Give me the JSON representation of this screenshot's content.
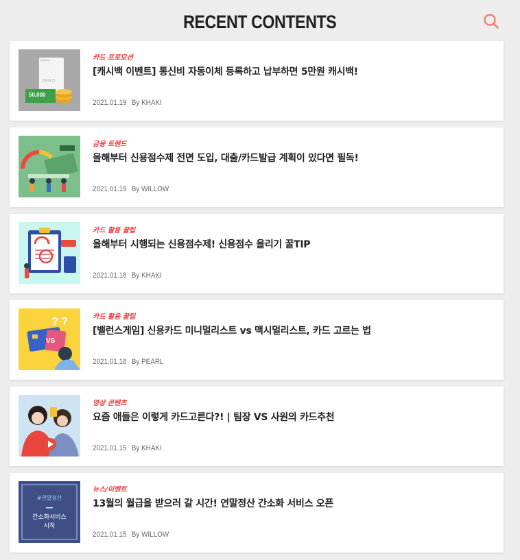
{
  "header": {
    "title": "RECENT CONTENTS",
    "search_icon": "search-icon",
    "accent": "#f07867"
  },
  "colors": {
    "category": "#ef3a3a",
    "background": "#ededed"
  },
  "posts": [
    {
      "category": "카드 프로모션",
      "title": "[캐시백 이벤트] 통신비 자동이체 등록하고 납부하면 5만원 캐시백!",
      "date": "2021.01.19",
      "by": "By",
      "author": "KHAKI",
      "thumb": {
        "card_text": "ZERO",
        "amount": "50,000"
      }
    },
    {
      "category": "금융 트렌드",
      "title": "올해부터 신용점수제 전면 도입, 대출/카드발급 계획이 있다면 필독!",
      "date": "2021.01.19",
      "by": "By",
      "author": "WILLOW"
    },
    {
      "category": "카드 활용 꿀팁",
      "title": "올해부터 시행되는 신용점수제! 신용점수 올리기 꿀TIP",
      "date": "2021.01.18",
      "by": "By",
      "author": "KHAKI"
    },
    {
      "category": "카드 활용 꿀팁",
      "title": "[밸런스게임] 신용카드 미니멀리스트 vs 맥시멀리스트, 카드 고르는 법",
      "date": "2021.01.18",
      "by": "By",
      "author": "PEARL",
      "thumb": {
        "vs": "VS",
        "marks": "? ?"
      }
    },
    {
      "category": "영상 콘텐츠",
      "title": "요즘 애들은 이렇게 카드고른다?! | 팀장 VS 사원의 카드추천",
      "date": "2021.01.15",
      "by": "By",
      "author": "KHAKI"
    },
    {
      "category": "뉴스/이벤트",
      "title": "13월의 월급을 받으러 갈 시간! 연말정산 간소화 서비스 오픈",
      "date": "2021.01.15",
      "by": "By",
      "author": "WILLOW",
      "thumb": {
        "tag": "#연말정산",
        "line1": "간소화서비스",
        "line2": "시작"
      }
    }
  ]
}
